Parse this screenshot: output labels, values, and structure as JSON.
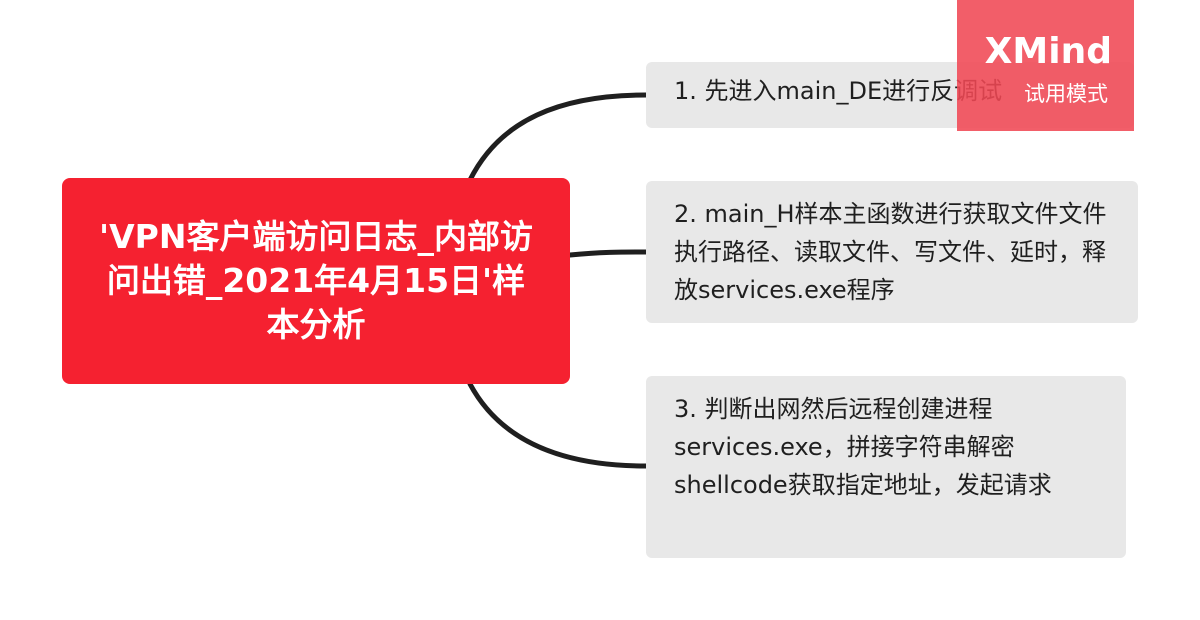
{
  "central_topic": {
    "text": "'VPN客户端访问日志_内部访问出错_2021年4月15日'样本分析"
  },
  "subtopics": [
    {
      "text": "1. 先进入main_DE进行反调试"
    },
    {
      "text": "2.  main_H样本主函数进行获取文件文件执行路径、读取文件、写文件、延时，释放services.exe程序"
    },
    {
      "text": "3. 判断出网然后远程创建进程services.exe，拼接字符串解密shellcode获取指定地址，发起请求"
    }
  ],
  "watermark": {
    "title": "XMind",
    "subtitle": "试用模式"
  },
  "colors": {
    "central_fill": "#f52130",
    "subtopic_fill": "#e8e8e8",
    "connector": "#1f1f1f",
    "watermark_fill": "#f04854"
  }
}
